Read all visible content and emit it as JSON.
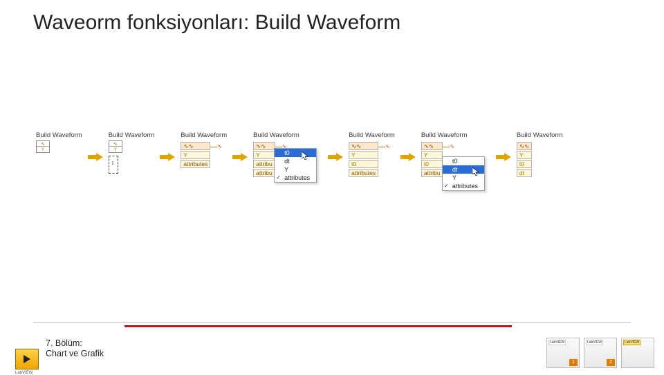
{
  "title": "Waveorm fonksiyonları: Build Waveform",
  "row": {
    "label": "Build Waveform",
    "terminals": {
      "wf": "∿∿",
      "y": "Y",
      "t0": "t0",
      "dt": "dt",
      "attr": "attributes",
      "attr_short": "attribu"
    }
  },
  "dropdown": {
    "items": [
      "t0",
      "dt",
      "Y",
      "attributes"
    ]
  },
  "node4": {
    "highlight": "t0",
    "checked": "attributes"
  },
  "node6": {
    "highlight": "dt",
    "checked": "attributes"
  },
  "chapter": {
    "line1": "7. Bölüm:",
    "line2": "Chart ve Grafik"
  },
  "books": {
    "tag_white": "LabVIEW",
    "tag_yellow": "LabVIEW",
    "n1": "1",
    "n2": "2"
  }
}
